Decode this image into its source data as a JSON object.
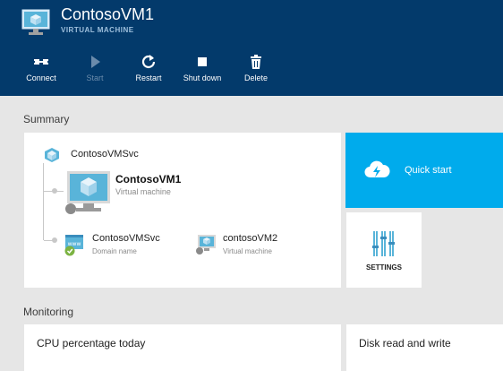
{
  "header": {
    "title": "ContosoVM1",
    "subtitle": "VIRTUAL MACHINE",
    "icon": "virtual-machine-icon"
  },
  "toolbar": {
    "connect": {
      "label": "Connect",
      "icon": "connect-icon",
      "enabled": true
    },
    "start": {
      "label": "Start",
      "icon": "play-icon",
      "enabled": false
    },
    "restart": {
      "label": "Restart",
      "icon": "restart-icon",
      "enabled": true
    },
    "shutdown": {
      "label": "Shut down",
      "icon": "stop-icon",
      "enabled": true
    },
    "delete": {
      "label": "Delete",
      "icon": "trash-icon",
      "enabled": true
    }
  },
  "summary": {
    "section_label": "Summary",
    "cloud_service": {
      "name": "ContosoVMSvc",
      "icon": "cloud-service-icon"
    },
    "current_vm": {
      "name": "ContosoVM1",
      "type": "Virtual machine"
    },
    "domain": {
      "name": "ContosoVMSvc",
      "type": "Domain name",
      "status": "ok"
    },
    "other_vm": {
      "name": "contosoVM2",
      "type": "Virtual machine"
    }
  },
  "tiles": {
    "quick_start": {
      "label": "Quick start",
      "icon": "cloud-lightning-icon"
    },
    "settings": {
      "label": "SETTINGS",
      "icon": "sliders-icon"
    }
  },
  "monitoring": {
    "section_label": "Monitoring",
    "cpu_title": "CPU percentage today",
    "disk_title": "Disk read and write"
  },
  "colors": {
    "header_bg": "#033a6b",
    "accent": "#00abec",
    "page_bg": "#e6e6e6",
    "status_ok": "#7cb342"
  }
}
